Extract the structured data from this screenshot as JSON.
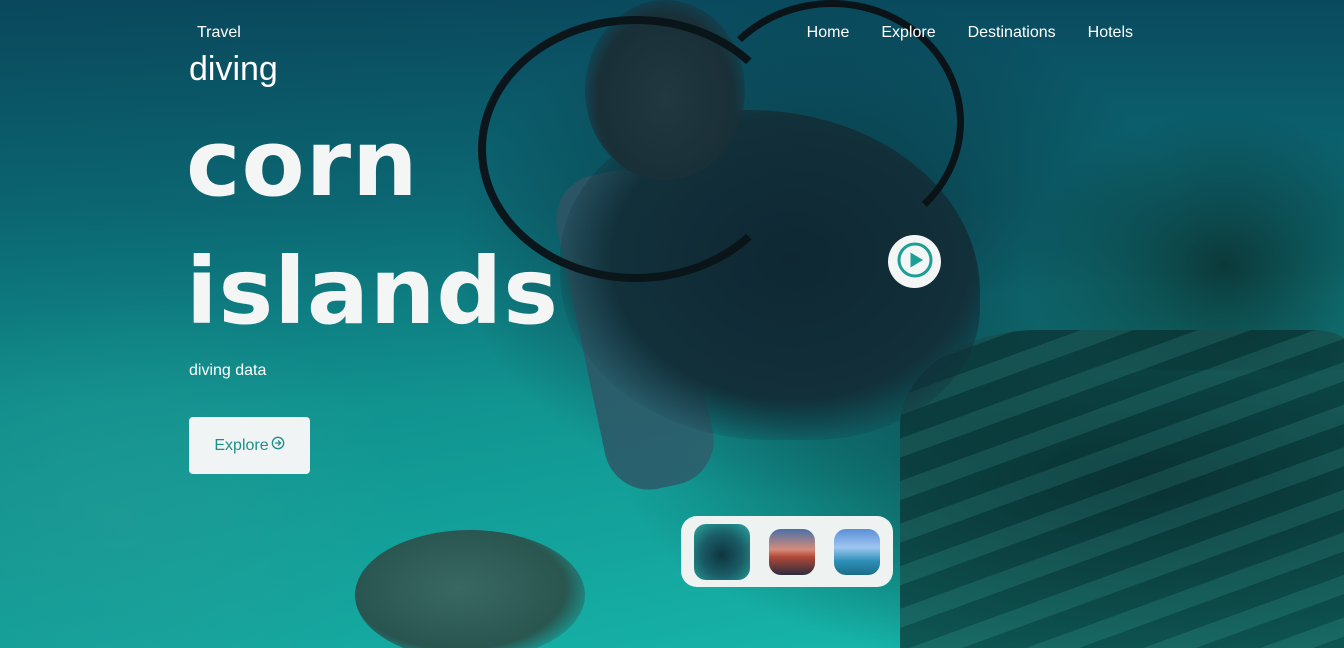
{
  "brand": {
    "label": "Travel"
  },
  "nav": {
    "items": [
      {
        "label": "Home"
      },
      {
        "label": "Explore"
      },
      {
        "label": "Destinations"
      },
      {
        "label": "Hotels"
      }
    ]
  },
  "hero": {
    "eyebrow": "diving",
    "title_line_1": "corn",
    "title_line_2": "islands",
    "subtext": "diving data",
    "cta_label": "Explore",
    "cta_icon": "arrow-circle-right-icon",
    "play_icon": "play-circle-icon"
  },
  "gallery": {
    "thumbnails": [
      {
        "icon": "diver-thumbnail"
      },
      {
        "icon": "sunset-thumbnail"
      },
      {
        "icon": "sailboat-thumbnail"
      }
    ]
  },
  "colors": {
    "accent": "#1f8f8a",
    "button_bg": "#f1f4f4",
    "text": "#ffffff"
  }
}
